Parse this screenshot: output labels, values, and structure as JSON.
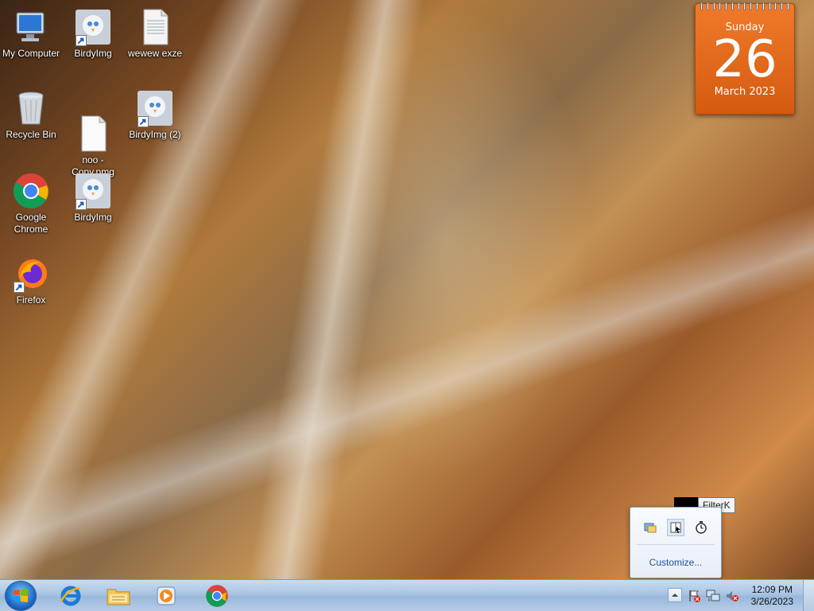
{
  "desktop": {
    "icons": [
      {
        "label": "My Computer",
        "icon": "computer-icon"
      },
      {
        "label": "BirdyImg",
        "icon": "bird-image-icon"
      },
      {
        "label": "wewew exze",
        "icon": "text-file-icon"
      },
      {
        "label": "Recycle Bin",
        "icon": "recycle-bin-icon"
      },
      {
        "label": "noo -\nCopy.pmg",
        "icon": "blank-file-icon"
      },
      {
        "label": "BirdyImg (2)",
        "icon": "bird-image-icon"
      },
      {
        "label": "Google\nChrome",
        "icon": "chrome-icon"
      },
      {
        "label": "BirdyImg",
        "icon": "bird-image-icon"
      },
      {
        "label": "Firefox",
        "icon": "firefox-icon"
      }
    ]
  },
  "calendar": {
    "day_name": "Sunday",
    "day_number": "26",
    "month_year": "March 2023"
  },
  "tray_popup": {
    "customize_label": "Customize...",
    "tooltip": "FilterK"
  },
  "taskbar": {
    "clock_time": "12:09 PM",
    "clock_date": "3/26/2023"
  },
  "colors": {
    "calendar_orange": "#e8671c",
    "taskbar_blue": "#a9c4e2",
    "link_blue": "#1e4f9c"
  }
}
